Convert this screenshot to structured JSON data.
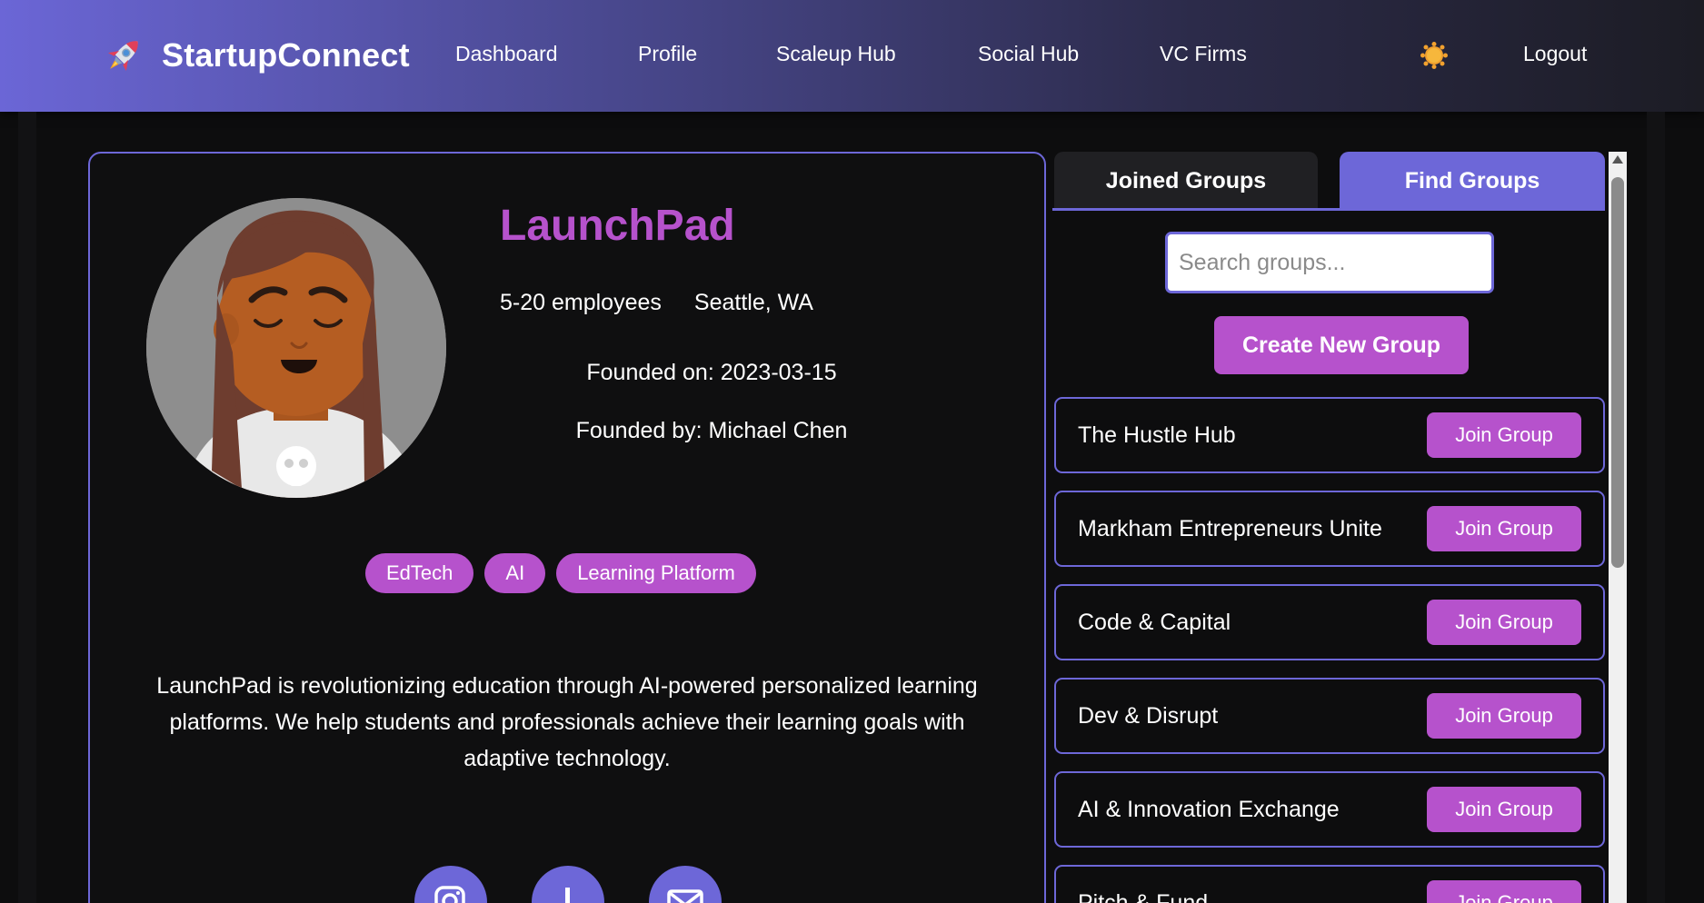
{
  "nav": {
    "brand": "StartupConnect",
    "links": [
      "Dashboard",
      "Profile",
      "Scaleup Hub",
      "Social Hub",
      "VC Firms"
    ],
    "logout": "Logout",
    "brand_icon": "rocket-icon",
    "theme_icon": "sun-icon"
  },
  "profile": {
    "name": "LaunchPad",
    "employees": "5-20 employees",
    "location": "Seattle, WA",
    "founded_on": "Founded on: 2023-03-15",
    "founded_by": "Founded by: Michael Chen",
    "tags": [
      "EdTech",
      "AI",
      "Learning Platform"
    ],
    "description": "LaunchPad is revolutionizing education through AI-powered personalized learning platforms. We help students and professionals achieve their learning goals with adaptive technology.",
    "social_icons": [
      "instagram-icon",
      "linkedin-icon",
      "email-icon"
    ]
  },
  "groups": {
    "tabs": [
      "Joined Groups",
      "Find Groups"
    ],
    "active_tab": "Find Groups",
    "search_placeholder": "Search groups...",
    "create_label": "Create New Group",
    "join_label": "Join Group",
    "items": [
      "The Hustle Hub",
      "Markham Entrepreneurs Unite",
      "Code & Capital",
      "Dev & Disrupt",
      "AI & Innovation Exchange",
      "Pitch & Fund"
    ]
  },
  "colors": {
    "accent_purple": "#6d67d8",
    "accent_magenta": "#b652cc",
    "background": "#0d0d0e"
  }
}
